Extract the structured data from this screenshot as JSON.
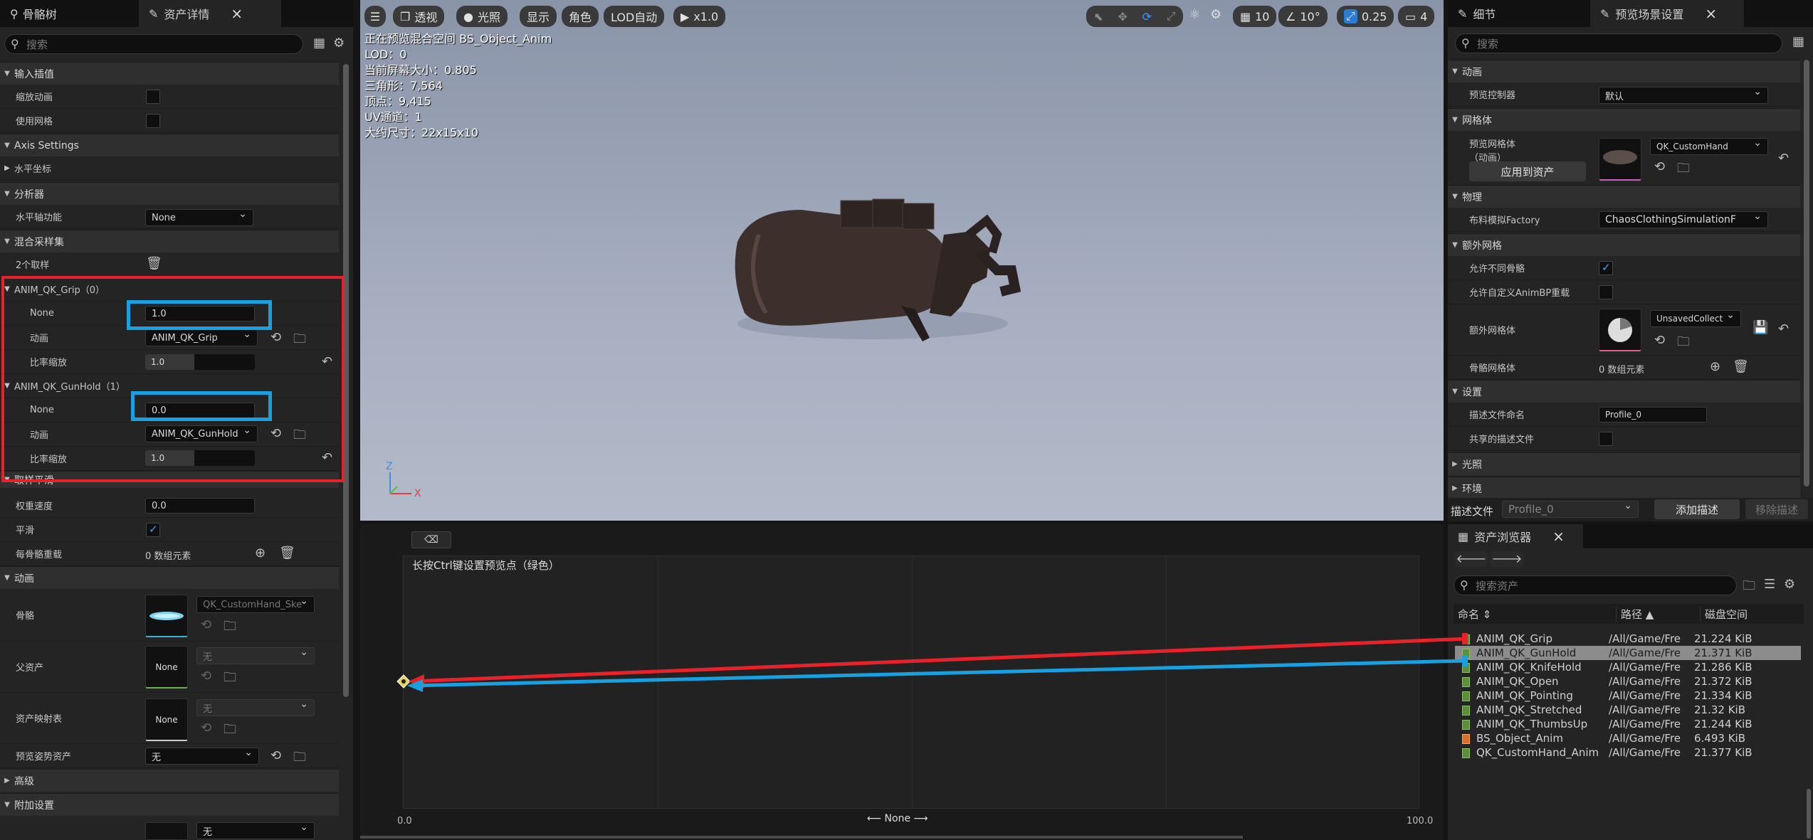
{
  "left_panel": {
    "tabs": [
      {
        "label": "骨骼树"
      },
      {
        "label": "资产详情"
      }
    ],
    "search_placeholder": "搜索",
    "sections": {
      "input_interp": "输入插值",
      "axis_settings": "Axis Settings",
      "analysis": "分析器",
      "blend_samples": "混合采样集",
      "animation": "动画",
      "advanced": "高级",
      "additive": "附加设置",
      "sample_smoothing": "取样平滑"
    },
    "rows": {
      "scale_anim": "缩放动画",
      "use_mesh": "使用网格",
      "horizontal_axis": "水平坐标",
      "h_axis_func": "水平轴功能",
      "h_axis_func_value": "None",
      "sample_count": "2个取样",
      "weight_speed": "权重速度",
      "weight_speed_value": "0.0",
      "smooth": "平滑",
      "per_bone": "每骨骼重载",
      "per_bone_value": "0 数组元素",
      "skeleton": "骨骼",
      "skeleton_value": "QK_CustomHand_Ske",
      "parent_asset": "父资产",
      "parent_value": "无",
      "asset_map": "资产映射表",
      "asset_map_value": "无",
      "none_thumb": "None",
      "preview_pose": "预览姿势资产",
      "preview_pose_value": "无",
      "bottom_value": "无"
    },
    "samples": [
      {
        "header": "ANIM_QK_Grip（0）",
        "none_label": "None",
        "none_value": "1.0",
        "anim_label": "动画",
        "anim_value": "ANIM_QK_Grip",
        "rate_label": "比率缩放",
        "rate_value": "1.0"
      },
      {
        "header": "ANIM_QK_GunHold（1）",
        "none_label": "None",
        "none_value": "0.0",
        "anim_label": "动画",
        "anim_value": "ANIM_QK_GunHold",
        "rate_label": "比率缩放",
        "rate_value": "1.0"
      }
    ]
  },
  "viewport": {
    "toolbar": {
      "perspective": "透视",
      "lit": "光照",
      "show": "显示",
      "character": "角色",
      "lod": "LOD自动",
      "play_speed": "x1.0",
      "grid": "10",
      "angle": "10°",
      "scale": "0.25",
      "camera": "4"
    },
    "stats": [
      "正在预览混合空间 BS_Object_Anim",
      "LOD：0",
      "当前屏幕大小：0.805",
      "三角形：7,564",
      "顶点：9,415",
      "UV通道：1",
      "大约尺寸：22x15x10"
    ],
    "axis_z": "Z",
    "axis_x": "X"
  },
  "blend_graph": {
    "hint": "长按Ctrl键设置预览点（绿色）",
    "x_min": "0.0",
    "x_max": "100.0",
    "axis_name": "None"
  },
  "right_panel": {
    "tabs": [
      {
        "label": "细节"
      },
      {
        "label": "预览场景设置"
      }
    ],
    "search_placeholder": "搜索",
    "sections": {
      "animation": "动画",
      "mesh": "网格体",
      "physics": "物理",
      "extra_mesh": "额外网格",
      "settings": "设置",
      "lighting": "光照",
      "environment": "环境"
    },
    "preview_controller": "预览控制器",
    "preview_controller_value": "默认",
    "preview_mesh": "预览网格体",
    "preview_mesh_sub": "（动画）",
    "preview_mesh_value": "QK_CustomHand",
    "apply_to_asset": "应用到资产",
    "cloth_factory": "布料模拟Factory",
    "cloth_factory_value": "ChaosClothingSimulationF",
    "allow_diff_skel": "允许不同骨骼",
    "allow_custom_animbp": "允许自定义AnimBP重载",
    "extra_mesh_label": "额外网格体",
    "extra_mesh_value": "UnsavedCollect",
    "skel_mesh": "骨骼网格体",
    "skel_mesh_value": "0 数组元素",
    "profile_name": "描述文件命名",
    "profile_name_value": "Profile_0",
    "shared_profile": "共享的描述文件",
    "profile_label": "描述文件",
    "profile_value": "Profile_0",
    "add_profile": "添加描述",
    "remove_profile": "移除描述"
  },
  "asset_browser": {
    "tab": "资产浏览器",
    "search_placeholder": "搜索资产",
    "columns": [
      "命名",
      "路径",
      "磁盘空间"
    ],
    "rows": [
      {
        "name": "ANIM_QK_Grip",
        "path": "/All/Game/Fre",
        "size": "21.224 KiB"
      },
      {
        "name": "ANIM_QK_GunHold",
        "path": "/All/Game/Fre",
        "size": "21.371 KiB"
      },
      {
        "name": "ANIM_QK_KnifeHold",
        "path": "/All/Game/Fre",
        "size": "21.286 KiB"
      },
      {
        "name": "ANIM_QK_Open",
        "path": "/All/Game/Fre",
        "size": "21.372 KiB"
      },
      {
        "name": "ANIM_QK_Pointing",
        "path": "/All/Game/Fre",
        "size": "21.334 KiB"
      },
      {
        "name": "ANIM_QK_Stretched",
        "path": "/All/Game/Fre",
        "size": "21.32 KiB"
      },
      {
        "name": "ANIM_QK_ThumbsUp",
        "path": "/All/Game/Fre",
        "size": "21.244 KiB"
      },
      {
        "name": "BS_Object_Anim",
        "path": "/All/Game/Fre",
        "size": "6.493 KiB"
      },
      {
        "name": "QK_CustomHand_Anim",
        "path": "/All/Game/Fre",
        "size": "21.377 KiB"
      }
    ]
  },
  "colors": {
    "highlight_red": "#e8222b",
    "highlight_blue": "#18a0e0",
    "accent": "#2a7bd4"
  }
}
